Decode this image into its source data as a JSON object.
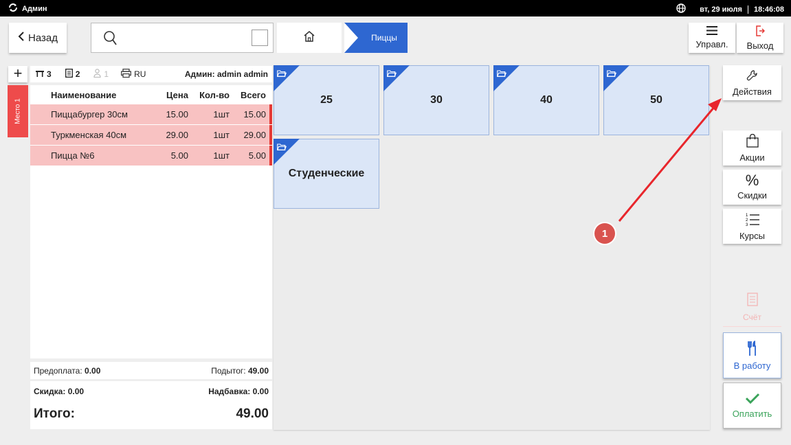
{
  "topbar": {
    "app_name": "Админ",
    "date": "вт, 29 июля",
    "time": "18:46:08"
  },
  "nav": {
    "back_label": "Назад",
    "breadcrumb_current": "Пиццы"
  },
  "header_buttons": {
    "manage_label": "Управл.",
    "exit_label": "Выход"
  },
  "order": {
    "table_number": "3",
    "guests": "2",
    "persons": "1",
    "language": "RU",
    "admin_label": "Админ: admin admin",
    "seat_label": "Место 1",
    "columns": {
      "name": "Наименование",
      "price": "Цена",
      "qty": "Кол-во",
      "total": "Всего"
    },
    "items": [
      {
        "name": "Пиццабургер 30см",
        "price": "15.00",
        "qty": "1шт",
        "total": "15.00"
      },
      {
        "name": "Туркменская 40см",
        "price": "29.00",
        "qty": "1шт",
        "total": "29.00"
      },
      {
        "name": "Пицца №6",
        "price": "5.00",
        "qty": "1шт",
        "total": "5.00"
      }
    ],
    "prepay_label": "Предоплата:",
    "prepay_value": "0.00",
    "subtotal_label": "Подытог:",
    "subtotal_value": "49.00",
    "discount_label": "Скидка:",
    "discount_value": "0.00",
    "surcharge_label": "Надбавка:",
    "surcharge_value": "0.00",
    "total_label": "Итого:",
    "total_value": "49.00"
  },
  "tiles": [
    "25",
    "30",
    "40",
    "50",
    "Студенческие"
  ],
  "side": {
    "actions_label": "Действия",
    "promos_label": "Акции",
    "discounts_label": "Скидки",
    "courses_label": "Курсы",
    "bill_label": "Счёт",
    "to_work_label": "В работу",
    "pay_label": "Оплатить"
  },
  "annotation": {
    "badge": "1"
  },
  "colors": {
    "accent": "#2e67d1",
    "danger": "#e53935",
    "success": "#3aa35a",
    "item_bg": "#f8c2c2"
  }
}
